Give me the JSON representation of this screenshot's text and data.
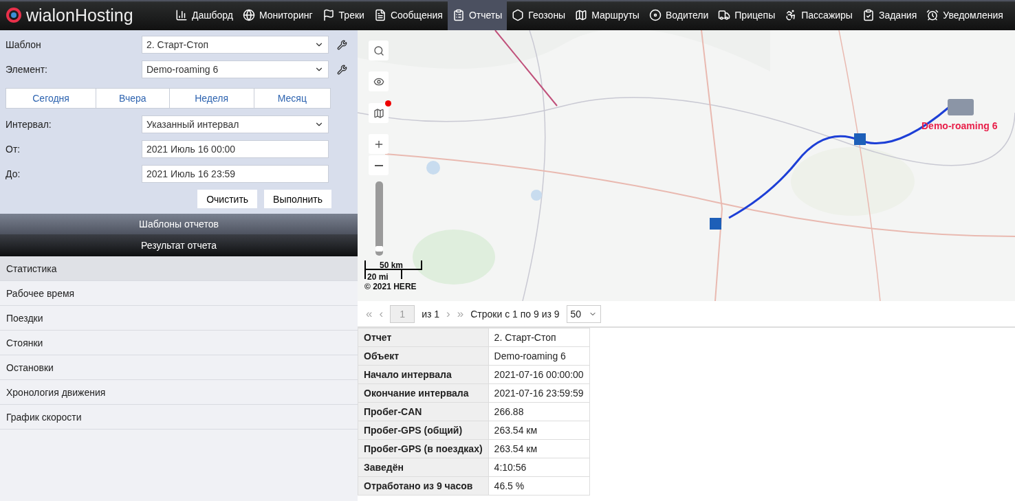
{
  "logo": {
    "brand": "wialon",
    "product": "Hosting"
  },
  "nav": [
    {
      "label": "Дашборд",
      "selected": false
    },
    {
      "label": "Мониторинг",
      "selected": false
    },
    {
      "label": "Треки",
      "selected": false
    },
    {
      "label": "Сообщения",
      "selected": false
    },
    {
      "label": "Отчеты",
      "selected": true
    },
    {
      "label": "Геозоны",
      "selected": false
    },
    {
      "label": "Маршруты",
      "selected": false
    },
    {
      "label": "Водители",
      "selected": false
    },
    {
      "label": "Прицепы",
      "selected": false
    },
    {
      "label": "Пассажиры",
      "selected": false
    },
    {
      "label": "Задания",
      "selected": false
    },
    {
      "label": "Уведомления",
      "selected": false
    }
  ],
  "form": {
    "fields": [
      {
        "kind": "select",
        "label": "Шаблон",
        "value": "2. Старт-Стоп",
        "tool": true
      },
      {
        "kind": "select",
        "label": "Элемент:",
        "value": "Demo-roaming 6",
        "tool": true
      },
      {
        "kind": "periods",
        "items": [
          {
            "label": "Сегодня"
          },
          {
            "label": "Вчера"
          },
          {
            "label": "Неделя"
          },
          {
            "label": "Месяц"
          }
        ]
      },
      {
        "kind": "select",
        "label": "Интервал:",
        "value": "Указанный интервал",
        "tool": false
      },
      {
        "kind": "input",
        "label": "От:",
        "value": "2021 Июль 16 00:00"
      },
      {
        "kind": "input",
        "label": "До:",
        "value": "2021 Июль 16 23:59"
      }
    ],
    "buttons": [
      "Очистить",
      "Выполнить"
    ]
  },
  "sections": [
    "Шаблоны отчетов",
    "Результат отчета"
  ],
  "results": [
    {
      "label": "Статистика",
      "selected": true
    },
    {
      "label": "Рабочее время",
      "selected": false
    },
    {
      "label": "Поездки",
      "selected": false
    },
    {
      "label": "Стоянки",
      "selected": false
    },
    {
      "label": "Остановки",
      "selected": false
    },
    {
      "label": "Хронология движения",
      "selected": false
    },
    {
      "label": "График скорости",
      "selected": false
    }
  ],
  "map": {
    "unit_label": "Demo-roaming 6",
    "scale_km": "50 km",
    "scale_mi": "20 mi",
    "copyright": "© 2021 HERE",
    "layers_alert": true,
    "zoom_slider": {
      "level": 0.06
    }
  },
  "pager": {
    "first": "«",
    "prev": "‹",
    "page": "1",
    "of": "из 1",
    "next": "›",
    "last": "»",
    "rows": "Строки с 1 по 9 из 9",
    "per_page": "50"
  },
  "table": {
    "rows": [
      [
        "Отчет",
        "2. Старт-Стоп"
      ],
      [
        "Объект",
        "Demo-roaming 6"
      ],
      [
        "Начало интервала",
        "2021-07-16 00:00:00"
      ],
      [
        "Окончание интервала",
        "2021-07-16 23:59:59"
      ],
      [
        "Пробег-CAN",
        "266.88"
      ],
      [
        "Пробег-GPS (общий)",
        "263.54 км"
      ],
      [
        "Пробег-GPS (в поездках)",
        "263.54 км"
      ],
      [
        "Заведён",
        "4:10:56"
      ],
      [
        "Отработано из 9 часов",
        "46.5 %"
      ]
    ]
  }
}
